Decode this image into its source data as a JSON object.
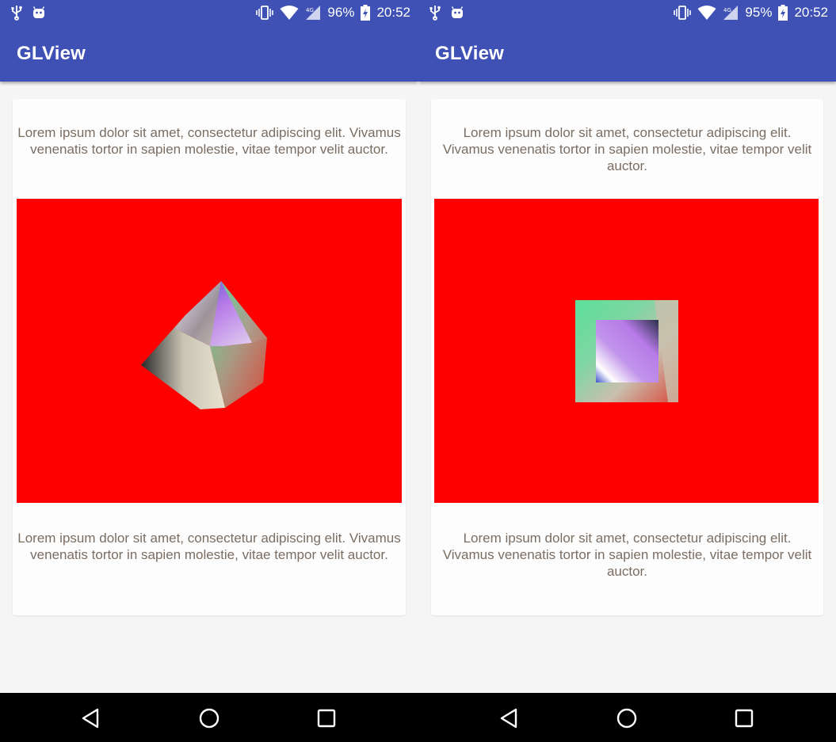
{
  "screens": [
    {
      "id": "left",
      "status": {
        "battery": "96%",
        "time": "20:52",
        "network": "4G"
      },
      "app_title": "GLView",
      "text_top": "Lorem ipsum dolor sit amet, consectetur adipiscing elit. Vivamus venenatis tortor in sapien molestie, vitae tempor velit auctor.",
      "text_bottom": "Lorem ipsum dolor sit amet, consectetur adipiscing elit. Vivamus venenatis tortor in sapien molestie, vitae tempor velit auctor.",
      "gl_background": "#ff0000"
    },
    {
      "id": "right",
      "status": {
        "battery": "95%",
        "time": "20:52",
        "network": "4G"
      },
      "app_title": "GLView",
      "text_top": "Lorem ipsum dolor sit amet, consectetur adipiscing elit. Vivamus venenatis tortor in sapien molestie, vitae tempor velit auctor.",
      "text_bottom": "Lorem ipsum dolor sit amet, consectetur adipiscing elit. Vivamus venenatis tortor in sapien molestie, vitae tempor velit auctor.",
      "gl_background": "#ff0000"
    }
  ],
  "navbar": {
    "buttons": [
      "back-icon",
      "home-icon",
      "recents-icon"
    ]
  },
  "colors": {
    "app_bar": "#3f51b5",
    "gl_clear": "#ff0000",
    "text": "#7a6d62"
  }
}
